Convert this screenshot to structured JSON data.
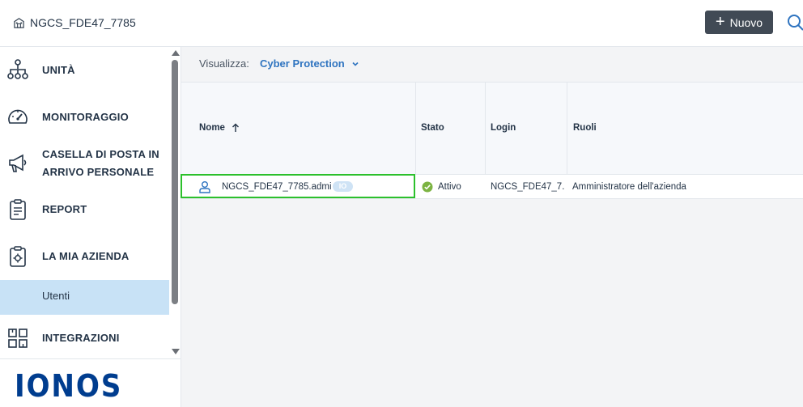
{
  "header": {
    "tenant_name": "NGCS_FDE47_7785",
    "new_button_label": "Nuovo",
    "icons": {
      "tenant": "building-icon",
      "search": "search-icon",
      "add": "plus-icon"
    }
  },
  "sidebar": {
    "items": [
      {
        "label": "UNITÀ",
        "icon": "hierarchy-icon"
      },
      {
        "label": "MONITORAGGIO",
        "icon": "gauge-icon"
      },
      {
        "label_line1": "CASELLA DI POSTA IN",
        "label_line2": "ARRIVO PERSONALE",
        "icon": "megaphone-icon"
      },
      {
        "label": "REPORT",
        "icon": "clipboard-report-icon"
      },
      {
        "label": "LA MIA AZIENDA",
        "icon": "clipboard-gear-icon"
      },
      {
        "label": "Utenti",
        "selected": true
      },
      {
        "label": "INTEGRAZIONI",
        "icon": "integrations-grid-icon"
      }
    ],
    "brand": "IONOS"
  },
  "main": {
    "view_label": "Visualizza:",
    "view_value": "Cyber Protection",
    "table": {
      "columns": [
        "Nome",
        "Stato",
        "Login",
        "Ruoli"
      ],
      "sort": {
        "column": "Nome",
        "direction": "ascending"
      },
      "rows": [
        {
          "name": "NGCS_FDE47_7785.admin",
          "badge": "IO",
          "status": "Attivo",
          "login": "NGCS_FDE47_7...",
          "roles": "Amministratore dell'azienda",
          "highlighted": true
        }
      ]
    }
  },
  "colors": {
    "accent": "#2f74c0",
    "button_bg": "#414a55",
    "selected_nav": "#c8e2f6",
    "highlight_border": "#2cc02c",
    "status_ok": "#7cb342",
    "brand": "#003d8f"
  }
}
